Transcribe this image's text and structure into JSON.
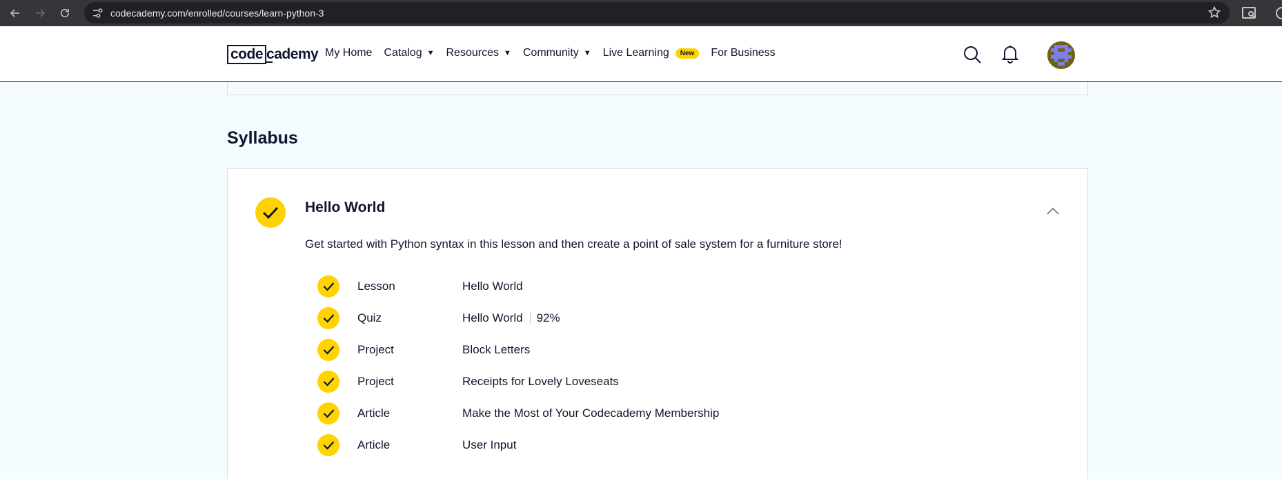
{
  "browser": {
    "url": "codecademy.com/enrolled/courses/learn-python-3"
  },
  "header": {
    "logo_code": "code",
    "logo_rest": "cademy",
    "nav": [
      {
        "label": "My Home",
        "dropdown": false
      },
      {
        "label": "Catalog",
        "dropdown": true
      },
      {
        "label": "Resources",
        "dropdown": true
      },
      {
        "label": "Community",
        "dropdown": true
      },
      {
        "label": "Live Learning",
        "dropdown": false,
        "badge": "New"
      },
      {
        "label": "For Business",
        "dropdown": false
      }
    ],
    "icons": [
      "search-icon",
      "bell-icon",
      "user-avatar"
    ]
  },
  "syllabus": {
    "title": "Syllabus",
    "module": {
      "title": "Hello World",
      "description": "Get started with Python syntax in this lesson and then create a point of sale system for a furniture store!",
      "items": [
        {
          "type": "Lesson",
          "name": "Hello World",
          "score": ""
        },
        {
          "type": "Quiz",
          "name": "Hello World",
          "score": "92%"
        },
        {
          "type": "Project",
          "name": "Block Letters",
          "score": ""
        },
        {
          "type": "Project",
          "name": "Receipts for Lovely Loveseats",
          "score": ""
        },
        {
          "type": "Article",
          "name": "Make the Most of Your Codecademy Membership",
          "score": ""
        },
        {
          "type": "Article",
          "name": "User Input",
          "score": ""
        }
      ]
    }
  },
  "colors": {
    "accent_yellow": "#ffd300",
    "navy": "#10162f",
    "page_bg": "#f5fcff"
  }
}
